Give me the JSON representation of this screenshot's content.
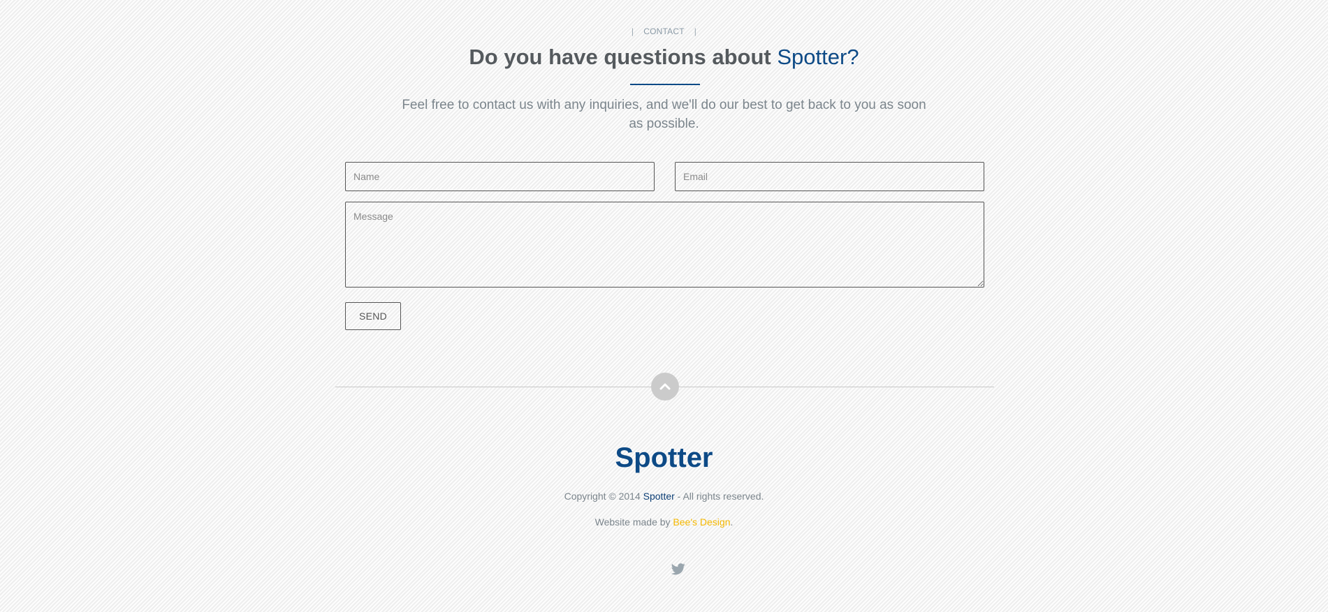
{
  "contact_section": {
    "label": "CONTACT",
    "heading_text": "Do you have questions about",
    "heading_brand": "Spotter?",
    "intro": "Feel free to contact us with any inquiries, and we'll do our best to get back to you as soon as possible."
  },
  "form": {
    "name_placeholder": "Name",
    "email_placeholder": "Email",
    "message_placeholder": "Message",
    "send_label": "SEND"
  },
  "footer": {
    "logo": "Spotter",
    "copyright_prefix": "Copyright © 2014",
    "copyright_brand": "Spotter",
    "copyright_suffix": "- All rights reserved.",
    "credit_prefix": "Website made by",
    "credit_designer": "Bee's Design",
    "credit_suffix": ".",
    "social_icons": [
      "twitter-icon"
    ]
  },
  "icons": {
    "scroll_top": "chevron-up-icon",
    "social": "twitter-icon"
  },
  "colors": {
    "brand": "#0d4a86",
    "accent": "#f5b800",
    "text": "#555a5e",
    "muted": "#7b858c"
  }
}
